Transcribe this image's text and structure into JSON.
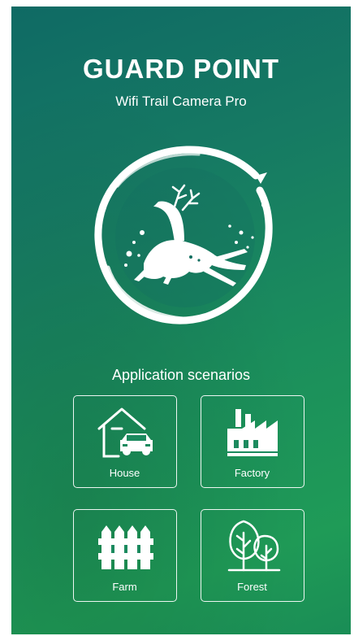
{
  "header": {
    "title": "GUARD POINT",
    "subtitle": "Wifi Trail Camera Pro"
  },
  "logo": {
    "icon": "deer-in-circle-icon"
  },
  "scenarios": {
    "heading": "Application scenarios",
    "items": [
      {
        "label": "House",
        "icon": "house-car-icon"
      },
      {
        "label": "Factory",
        "icon": "factory-icon"
      },
      {
        "label": "Farm",
        "icon": "fence-icon"
      },
      {
        "label": "Forest",
        "icon": "trees-icon"
      }
    ]
  },
  "colors": {
    "background_top": "#0f6a64",
    "background_bottom": "#1f9b57",
    "foreground": "#ffffff"
  }
}
